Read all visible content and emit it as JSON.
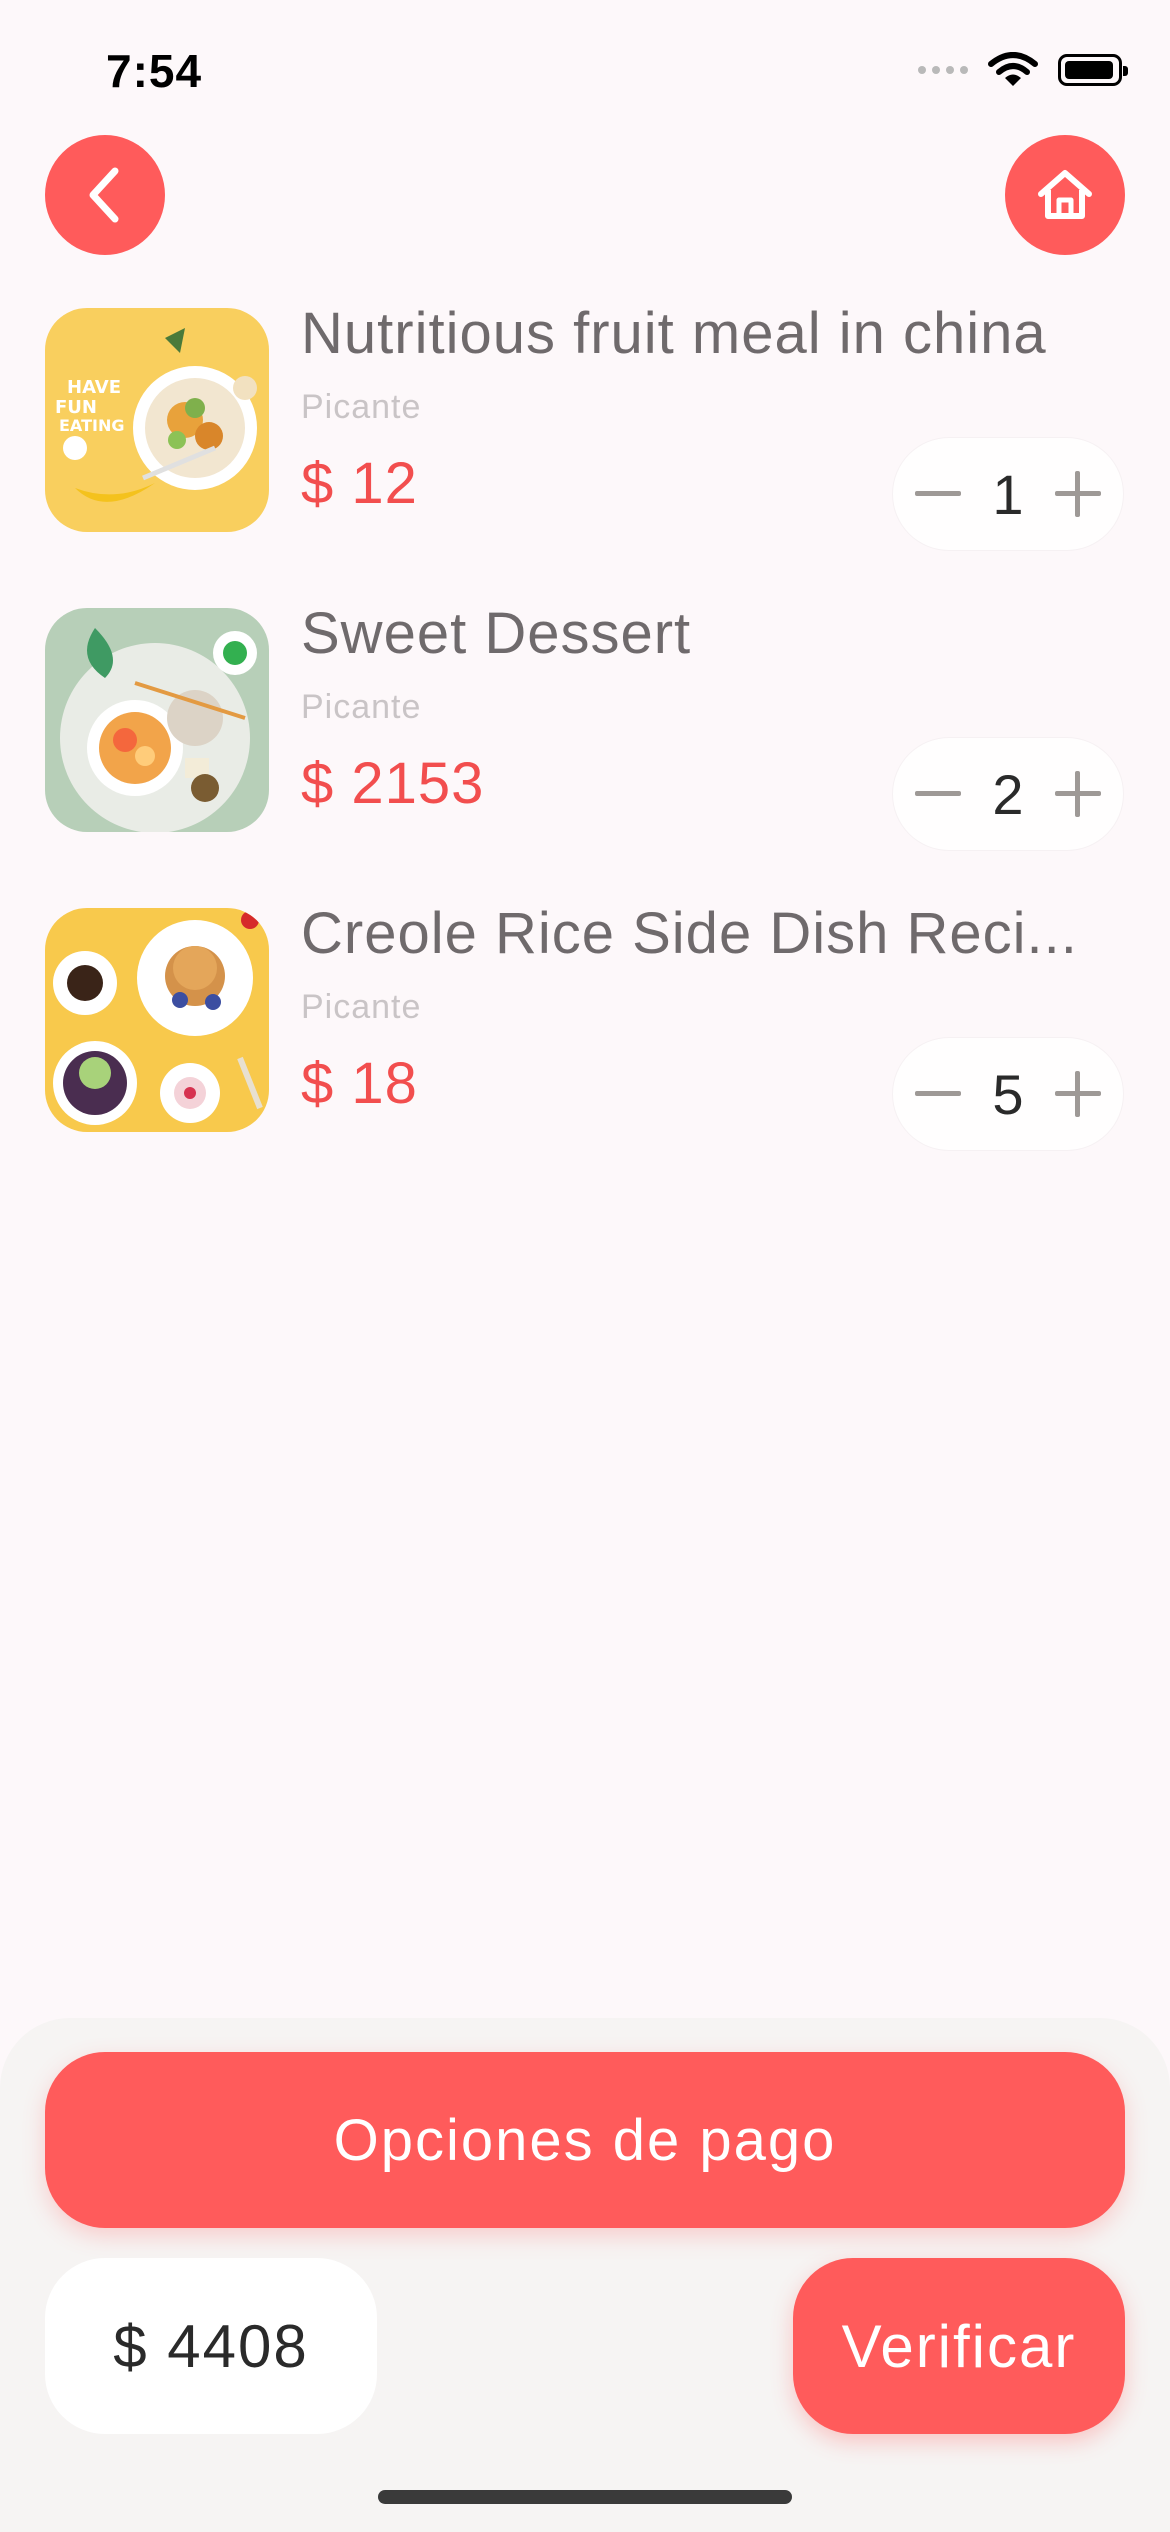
{
  "status_bar": {
    "time": "7:54"
  },
  "header": {
    "back_icon": "chevron-left-icon",
    "home_icon": "home-icon"
  },
  "cart": {
    "items": [
      {
        "title": "Nutritious fruit meal in china",
        "subtitle": "Picante",
        "price": "$ 12",
        "quantity": "1"
      },
      {
        "title": "Sweet Dessert",
        "subtitle": "Picante",
        "price": "$ 2153",
        "quantity": "2"
      },
      {
        "title": "Creole Rice Side Dish Reci...",
        "subtitle": "Picante",
        "price": "$ 18",
        "quantity": "5"
      }
    ]
  },
  "footer": {
    "payment_options_label": "Opciones de pago",
    "total": "$ 4408",
    "verify_label": "Verificar"
  },
  "colors": {
    "accent": "#ff5b5b",
    "price": "#f24e4e",
    "background": "#fdf8fa"
  }
}
